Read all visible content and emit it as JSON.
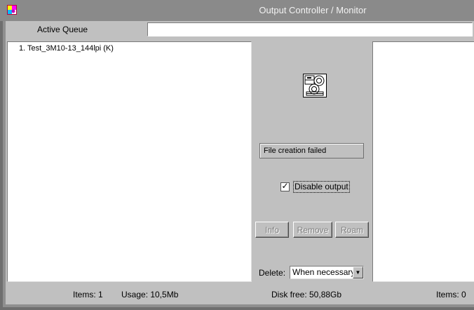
{
  "window": {
    "title": "Output Controller / Monitor",
    "app_icon": "app-palette-icon"
  },
  "queue": {
    "label": "Active Queue",
    "input_value": ""
  },
  "left_list": {
    "items": [
      "1. Test_3M10-13_144lpi (K)"
    ]
  },
  "center": {
    "device_icon": "imagesetter-device-icon",
    "status_message": "File creation failed",
    "disable_output": {
      "label": "Disable output",
      "checked": true
    },
    "buttons": {
      "info": "Info",
      "remove": "Remove",
      "roam": "Roam"
    },
    "delete": {
      "label": "Delete:",
      "selected": "When necessary"
    }
  },
  "right_list": {
    "items": []
  },
  "statusbar": {
    "items_left": "Items:  1",
    "usage": "Usage: 10,5Mb",
    "disk_free": "Disk free:  50,88Gb",
    "items_right": "Items:  0"
  },
  "colors": {
    "titlebar": "#8a8a8a",
    "face": "#c0c0c0",
    "disabled_text": "#808080"
  }
}
